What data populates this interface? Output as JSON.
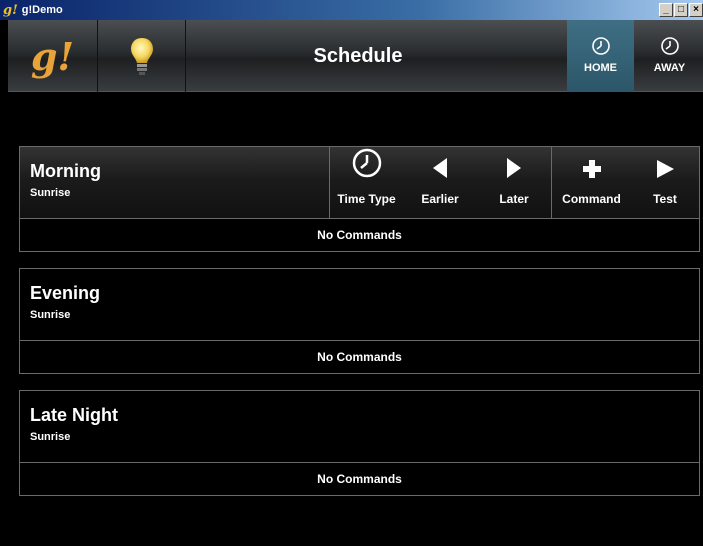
{
  "window": {
    "logo": "g!",
    "title": "g!Demo",
    "min": "_",
    "max": "□",
    "close": "×"
  },
  "header": {
    "logo": "g!",
    "title": "Schedule",
    "modes": [
      {
        "label": "HOME",
        "icon": "clock-icon",
        "active": true
      },
      {
        "label": "AWAY",
        "icon": "clock-icon",
        "active": false
      }
    ]
  },
  "toolbar": {
    "time_type": "Time Type",
    "earlier": "Earlier",
    "later": "Later",
    "command": "Command",
    "test": "Test"
  },
  "schedules": [
    {
      "title": "Morning",
      "subtitle": "Sunrise",
      "commands": "No Commands"
    },
    {
      "title": "Evening",
      "subtitle": "Sunrise",
      "commands": "No Commands"
    },
    {
      "title": "Late Night",
      "subtitle": "Sunrise",
      "commands": "No Commands"
    }
  ],
  "colors": {
    "accent": "#2c5669",
    "logo": "#e8a33a",
    "border": "#6a6a6a"
  }
}
